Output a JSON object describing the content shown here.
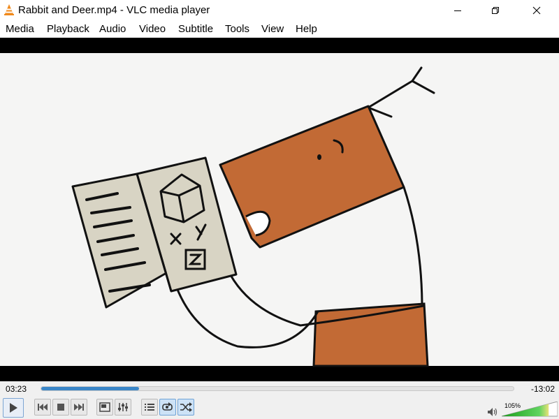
{
  "window": {
    "title": "Rabbit and Deer.mp4 - VLC media player",
    "controls": {
      "minimize_icon": "minimize-icon",
      "maximize_icon": "restore-icon",
      "close_icon": "close-icon"
    }
  },
  "menu": [
    "Media",
    "Playback",
    "Audio",
    "Video",
    "Subtitle",
    "Tools",
    "View",
    "Help"
  ],
  "player": {
    "time_elapsed": "03:23",
    "time_remaining": "-13:02",
    "progress": 0.207,
    "volume_label": "105%",
    "volume": 1.05
  },
  "controls": {
    "play": "play-icon",
    "previous": "skip-previous-icon",
    "stop": "stop-icon",
    "next": "skip-next-icon",
    "fullscreen": "fullscreen-icon",
    "extended_settings": "equalizer-icon",
    "playlist": "playlist-icon",
    "loop": "loop-icon",
    "random": "shuffle-icon",
    "mute": "speaker-icon"
  },
  "colors": {
    "accent": "#3a86c8",
    "video_letterbox": "#000000",
    "character_body": "#c26a35",
    "book_page": "#d8d4c4",
    "volume_green": "#2fbf2f"
  }
}
